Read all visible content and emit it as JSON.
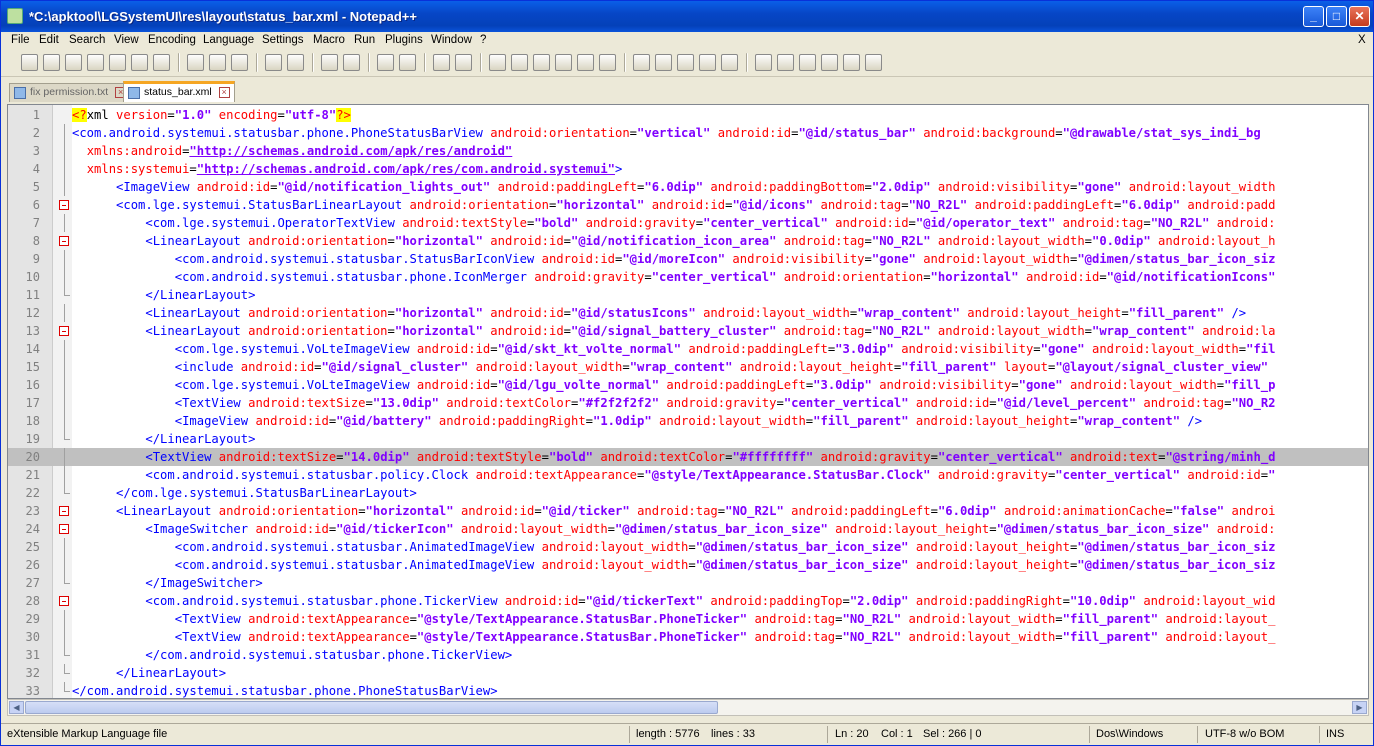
{
  "window": {
    "title": "*C:\\apktool\\LGSystemUI\\res\\layout\\status_bar.xml - Notepad++"
  },
  "menu": [
    "File",
    "Edit",
    "Search",
    "View",
    "Encoding",
    "Language",
    "Settings",
    "Macro",
    "Run",
    "Plugins",
    "Window",
    "?"
  ],
  "menu_close": "X",
  "tabs": [
    {
      "label": "fix permission.txt",
      "active": false
    },
    {
      "label": "status_bar.xml",
      "active": true
    }
  ],
  "editor": {
    "highlight_line": 20,
    "lines": [
      {
        "n": "1",
        "html": "<span class=\"pi\">&lt;?</span><span class=\"txt\">xml </span><span class=\"attr\">version</span><span class=\"txt\">=</span><span class=\"val\">\"1.0\"</span><span class=\"txt\"> </span><span class=\"attr\">encoding</span><span class=\"txt\">=</span><span class=\"val\">\"utf-8\"</span><span class=\"pi\">?&gt;</span>",
        "fold": "none"
      },
      {
        "n": "2",
        "html": "<span class=\"tag\">&lt;com.android.systemui.statusbar.phone.PhoneStatusBarView</span> <span class=\"attr\">android:orientation</span>=<span class=\"val\">\"vertical\"</span> <span class=\"attr\">android:id</span>=<span class=\"val\">\"@id/status_bar\"</span> <span class=\"attr\">android:background</span>=<span class=\"val\">\"@drawable/stat_sys_indi_bg</span>",
        "fold": "bar"
      },
      {
        "n": "3",
        "html": "  <span class=\"attr\">xmlns:android</span>=<span class=\"url\">\"http://schemas.android.com/apk/res/android\"</span>",
        "fold": "bar"
      },
      {
        "n": "4",
        "html": "  <span class=\"attr\">xmlns:systemui</span>=<span class=\"url\">\"http://schemas.android.com/apk/res/com.android.systemui\"</span><span class=\"tag\">&gt;</span>",
        "fold": "bar"
      },
      {
        "n": "5",
        "html": "      <span class=\"tag\">&lt;ImageView</span> <span class=\"attr\">android:id</span>=<span class=\"val\">\"@id/notification_lights_out\"</span> <span class=\"attr\">android:paddingLeft</span>=<span class=\"val\">\"6.0dip\"</span> <span class=\"attr\">android:paddingBottom</span>=<span class=\"val\">\"2.0dip\"</span> <span class=\"attr\">android:visibility</span>=<span class=\"val\">\"gone\"</span> <span class=\"attr\">android:layout_width</span>",
        "fold": "bar"
      },
      {
        "n": "6",
        "html": "      <span class=\"tag\">&lt;com.lge.systemui.StatusBarLinearLayout</span> <span class=\"attr\">android:orientation</span>=<span class=\"val\">\"horizontal\"</span> <span class=\"attr\">android:id</span>=<span class=\"val\">\"@id/icons\"</span> <span class=\"attr\">android:tag</span>=<span class=\"val\">\"NO_R2L\"</span> <span class=\"attr\">android:paddingLeft</span>=<span class=\"val\">\"6.0dip\"</span> <span class=\"attr\">android:padd</span>",
        "fold": "box"
      },
      {
        "n": "7",
        "html": "          <span class=\"tag\">&lt;com.lge.systemui.OperatorTextView</span> <span class=\"attr\">android:textStyle</span>=<span class=\"val\">\"bold\"</span> <span class=\"attr\">android:gravity</span>=<span class=\"val\">\"center_vertical\"</span> <span class=\"attr\">android:id</span>=<span class=\"val\">\"@id/operator_text\"</span> <span class=\"attr\">android:tag</span>=<span class=\"val\">\"NO_R2L\"</span> <span class=\"attr\">android:</span>",
        "fold": "bar"
      },
      {
        "n": "8",
        "html": "          <span class=\"tag\">&lt;LinearLayout</span> <span class=\"attr\">android:orientation</span>=<span class=\"val\">\"horizontal\"</span> <span class=\"attr\">android:id</span>=<span class=\"val\">\"@id/notification_icon_area\"</span> <span class=\"attr\">android:tag</span>=<span class=\"val\">\"NO_R2L\"</span> <span class=\"attr\">android:layout_width</span>=<span class=\"val\">\"0.0dip\"</span> <span class=\"attr\">android:layout_h</span>",
        "fold": "box"
      },
      {
        "n": "9",
        "html": "              <span class=\"tag\">&lt;com.android.systemui.statusbar.StatusBarIconView</span> <span class=\"attr\">android:id</span>=<span class=\"val\">\"@id/moreIcon\"</span> <span class=\"attr\">android:visibility</span>=<span class=\"val\">\"gone\"</span> <span class=\"attr\">android:layout_width</span>=<span class=\"val\">\"@dimen/status_bar_icon_siz</span>",
        "fold": "bar"
      },
      {
        "n": "10",
        "html": "              <span class=\"tag\">&lt;com.android.systemui.statusbar.phone.IconMerger</span> <span class=\"attr\">android:gravity</span>=<span class=\"val\">\"center_vertical\"</span> <span class=\"attr\">android:orientation</span>=<span class=\"val\">\"horizontal\"</span> <span class=\"attr\">android:id</span>=<span class=\"val\">\"@id/notificationIcons\"</span>",
        "fold": "bar"
      },
      {
        "n": "11",
        "html": "          <span class=\"tag\">&lt;/LinearLayout&gt;</span>",
        "fold": "end"
      },
      {
        "n": "12",
        "html": "          <span class=\"tag\">&lt;LinearLayout</span> <span class=\"attr\">android:orientation</span>=<span class=\"val\">\"horizontal\"</span> <span class=\"attr\">android:id</span>=<span class=\"val\">\"@id/statusIcons\"</span> <span class=\"attr\">android:layout_width</span>=<span class=\"val\">\"wrap_content\"</span> <span class=\"attr\">android:layout_height</span>=<span class=\"val\">\"fill_parent\"</span> <span class=\"tag\">/&gt;</span>",
        "fold": "bar"
      },
      {
        "n": "13",
        "html": "          <span class=\"tag\">&lt;LinearLayout</span> <span class=\"attr\">android:orientation</span>=<span class=\"val\">\"horizontal\"</span> <span class=\"attr\">android:id</span>=<span class=\"val\">\"@id/signal_battery_cluster\"</span> <span class=\"attr\">android:tag</span>=<span class=\"val\">\"NO_R2L\"</span> <span class=\"attr\">android:layout_width</span>=<span class=\"val\">\"wrap_content\"</span> <span class=\"attr\">android:la</span>",
        "fold": "box"
      },
      {
        "n": "14",
        "html": "              <span class=\"tag\">&lt;com.lge.systemui.VoLteImageView</span> <span class=\"attr\">android:id</span>=<span class=\"val\">\"@id/skt_kt_volte_normal\"</span> <span class=\"attr\">android:paddingLeft</span>=<span class=\"val\">\"3.0dip\"</span> <span class=\"attr\">android:visibility</span>=<span class=\"val\">\"gone\"</span> <span class=\"attr\">android:layout_width</span>=<span class=\"val\">\"fil</span>",
        "fold": "bar"
      },
      {
        "n": "15",
        "html": "              <span class=\"tag\">&lt;include</span> <span class=\"attr\">android:id</span>=<span class=\"val\">\"@id/signal_cluster\"</span> <span class=\"attr\">android:layout_width</span>=<span class=\"val\">\"wrap_content\"</span> <span class=\"attr\">android:layout_height</span>=<span class=\"val\">\"fill_parent\"</span> <span class=\"attr\">layout</span>=<span class=\"val\">\"@layout/signal_cluster_view\"</span>",
        "fold": "bar"
      },
      {
        "n": "16",
        "html": "              <span class=\"tag\">&lt;com.lge.systemui.VoLteImageView</span> <span class=\"attr\">android:id</span>=<span class=\"val\">\"@id/lgu_volte_normal\"</span> <span class=\"attr\">android:paddingLeft</span>=<span class=\"val\">\"3.0dip\"</span> <span class=\"attr\">android:visibility</span>=<span class=\"val\">\"gone\"</span> <span class=\"attr\">android:layout_width</span>=<span class=\"val\">\"fill_p</span>",
        "fold": "bar"
      },
      {
        "n": "17",
        "html": "              <span class=\"tag\">&lt;TextView</span> <span class=\"attr\">android:textSize</span>=<span class=\"val\">\"13.0dip\"</span> <span class=\"attr\">android:textColor</span>=<span class=\"val\">\"#f2f2f2f2\"</span> <span class=\"attr\">android:gravity</span>=<span class=\"val\">\"center_vertical\"</span> <span class=\"attr\">android:id</span>=<span class=\"val\">\"@id/level_percent\"</span> <span class=\"attr\">android:tag</span>=<span class=\"val\">\"NO_R2</span>",
        "fold": "bar"
      },
      {
        "n": "18",
        "html": "              <span class=\"tag\">&lt;ImageView</span> <span class=\"attr\">android:id</span>=<span class=\"val\">\"@id/battery\"</span> <span class=\"attr\">android:paddingRight</span>=<span class=\"val\">\"1.0dip\"</span> <span class=\"attr\">android:layout_width</span>=<span class=\"val\">\"fill_parent\"</span> <span class=\"attr\">android:layout_height</span>=<span class=\"val\">\"wrap_content\"</span> <span class=\"tag\">/&gt;</span>",
        "fold": "bar"
      },
      {
        "n": "19",
        "html": "          <span class=\"tag\">&lt;/LinearLayout&gt;</span>",
        "fold": "end"
      },
      {
        "n": "20",
        "html": "          <span class=\"tag\">&lt;TextView</span> <span class=\"attr\">android:textSize</span>=<span class=\"val\">\"14.0dip\"</span> <span class=\"attr\">android:textStyle</span>=<span class=\"val\">\"bold\"</span> <span class=\"attr\">android:textColor</span>=<span class=\"val\">\"#ffffffff\"</span> <span class=\"attr\">android:gravity</span>=<span class=\"val\">\"center_vertical\"</span> <span class=\"attr\">android:text</span>=<span class=\"val\">\"@string/minh_d</span>",
        "fold": "bar"
      },
      {
        "n": "21",
        "html": "          <span class=\"tag\">&lt;com.android.systemui.statusbar.policy.Clock</span> <span class=\"attr\">android:textAppearance</span>=<span class=\"val\">\"@style/TextAppearance.StatusBar.Clock\"</span> <span class=\"attr\">android:gravity</span>=<span class=\"val\">\"center_vertical\"</span> <span class=\"attr\">android:id</span>=<span class=\"val\">\"</span>",
        "fold": "bar"
      },
      {
        "n": "22",
        "html": "      <span class=\"tag\">&lt;/com.lge.systemui.StatusBarLinearLayout&gt;</span>",
        "fold": "end"
      },
      {
        "n": "23",
        "html": "      <span class=\"tag\">&lt;LinearLayout</span> <span class=\"attr\">android:orientation</span>=<span class=\"val\">\"horizontal\"</span> <span class=\"attr\">android:id</span>=<span class=\"val\">\"@id/ticker\"</span> <span class=\"attr\">android:tag</span>=<span class=\"val\">\"NO_R2L\"</span> <span class=\"attr\">android:paddingLeft</span>=<span class=\"val\">\"6.0dip\"</span> <span class=\"attr\">android:animationCache</span>=<span class=\"val\">\"false\"</span> <span class=\"attr\">androi</span>",
        "fold": "box"
      },
      {
        "n": "24",
        "html": "          <span class=\"tag\">&lt;ImageSwitcher</span> <span class=\"attr\">android:id</span>=<span class=\"val\">\"@id/tickerIcon\"</span> <span class=\"attr\">android:layout_width</span>=<span class=\"val\">\"@dimen/status_bar_icon_size\"</span> <span class=\"attr\">android:layout_height</span>=<span class=\"val\">\"@dimen/status_bar_icon_size\"</span> <span class=\"attr\">android:</span>",
        "fold": "box"
      },
      {
        "n": "25",
        "html": "              <span class=\"tag\">&lt;com.android.systemui.statusbar.AnimatedImageView</span> <span class=\"attr\">android:layout_width</span>=<span class=\"val\">\"@dimen/status_bar_icon_size\"</span> <span class=\"attr\">android:layout_height</span>=<span class=\"val\">\"@dimen/status_bar_icon_siz</span>",
        "fold": "bar"
      },
      {
        "n": "26",
        "html": "              <span class=\"tag\">&lt;com.android.systemui.statusbar.AnimatedImageView</span> <span class=\"attr\">android:layout_width</span>=<span class=\"val\">\"@dimen/status_bar_icon_size\"</span> <span class=\"attr\">android:layout_height</span>=<span class=\"val\">\"@dimen/status_bar_icon_siz</span>",
        "fold": "bar"
      },
      {
        "n": "27",
        "html": "          <span class=\"tag\">&lt;/ImageSwitcher&gt;</span>",
        "fold": "end"
      },
      {
        "n": "28",
        "html": "          <span class=\"tag\">&lt;com.android.systemui.statusbar.phone.TickerView</span> <span class=\"attr\">android:id</span>=<span class=\"val\">\"@id/tickerText\"</span> <span class=\"attr\">android:paddingTop</span>=<span class=\"val\">\"2.0dip\"</span> <span class=\"attr\">android:paddingRight</span>=<span class=\"val\">\"10.0dip\"</span> <span class=\"attr\">android:layout_wid</span>",
        "fold": "box"
      },
      {
        "n": "29",
        "html": "              <span class=\"tag\">&lt;TextView</span> <span class=\"attr\">android:textAppearance</span>=<span class=\"val\">\"@style/TextAppearance.StatusBar.PhoneTicker\"</span> <span class=\"attr\">android:tag</span>=<span class=\"val\">\"NO_R2L\"</span> <span class=\"attr\">android:layout_width</span>=<span class=\"val\">\"fill_parent\"</span> <span class=\"attr\">android:layout_</span>",
        "fold": "bar"
      },
      {
        "n": "30",
        "html": "              <span class=\"tag\">&lt;TextView</span> <span class=\"attr\">android:textAppearance</span>=<span class=\"val\">\"@style/TextAppearance.StatusBar.PhoneTicker\"</span> <span class=\"attr\">android:tag</span>=<span class=\"val\">\"NO_R2L\"</span> <span class=\"attr\">android:layout_width</span>=<span class=\"val\">\"fill_parent\"</span> <span class=\"attr\">android:layout_</span>",
        "fold": "bar"
      },
      {
        "n": "31",
        "html": "          <span class=\"tag\">&lt;/com.android.systemui.statusbar.phone.TickerView&gt;</span>",
        "fold": "end"
      },
      {
        "n": "32",
        "html": "      <span class=\"tag\">&lt;/LinearLayout&gt;</span>",
        "fold": "end"
      },
      {
        "n": "33",
        "html": "<span class=\"tag\">&lt;/com.android.systemui.statusbar.phone.PhoneStatusBarView&gt;</span>",
        "fold": "end"
      }
    ]
  },
  "status": {
    "filetype": "eXtensible Markup Language file",
    "length": "length : 5776",
    "lines": "lines : 33",
    "ln": "Ln : 20",
    "col": "Col : 1",
    "sel": "Sel : 266 | 0",
    "eol": "Dos\\Windows",
    "encoding": "UTF-8 w/o BOM",
    "mode": "INS"
  }
}
